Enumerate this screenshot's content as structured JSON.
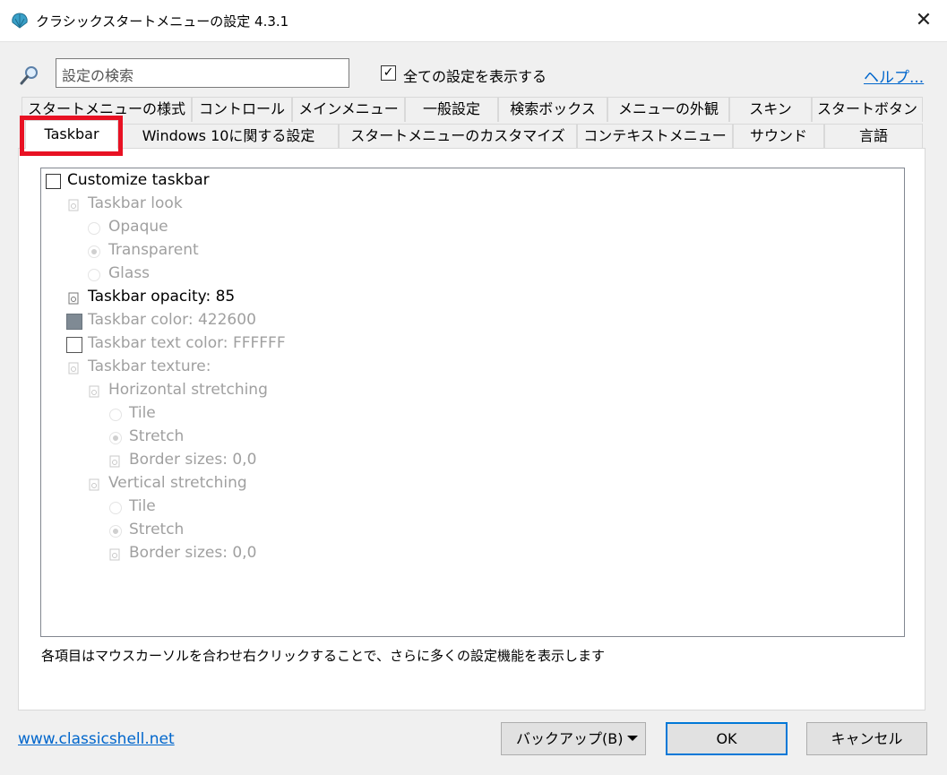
{
  "window": {
    "title": "クラシックスタートメニューの設定 4.3.1",
    "close_glyph": "✕"
  },
  "search": {
    "placeholder": "設定の検索",
    "show_all_label": "全ての設定を表示する",
    "show_all_checked": true,
    "help_link": "ヘルプ..."
  },
  "tabs_row1": [
    {
      "label": "スタートメニューの様式"
    },
    {
      "label": "コントロール"
    },
    {
      "label": "メインメニュー"
    },
    {
      "label": "一般設定"
    },
    {
      "label": "検索ボックス"
    },
    {
      "label": "メニューの外観"
    },
    {
      "label": "スキン"
    },
    {
      "label": "スタートボタン"
    }
  ],
  "tabs_row2": [
    {
      "label": "Taskbar",
      "active": true
    },
    {
      "label": "Windows 10に関する設定"
    },
    {
      "label": "スタートメニューのカスタマイズ"
    },
    {
      "label": "コンテキストメニュー"
    },
    {
      "label": "サウンド"
    },
    {
      "label": "言語"
    }
  ],
  "tree": {
    "customize_taskbar": "Customize taskbar",
    "taskbar_look": "Taskbar look",
    "opaque": "Opaque",
    "transparent": "Transparent",
    "glass": "Glass",
    "taskbar_opacity": "Taskbar opacity: 85",
    "taskbar_color": "Taskbar color: 422600",
    "taskbar_text_color": "Taskbar text color: FFFFFF",
    "taskbar_texture": "Taskbar texture:",
    "horizontal_stretching": "Horizontal stretching",
    "h_tile": "Tile",
    "h_stretch": "Stretch",
    "h_border_sizes": "Border sizes: 0,0",
    "vertical_stretching": "Vertical stretching",
    "v_tile": "Tile",
    "v_stretch": "Stretch",
    "v_border_sizes": "Border sizes: 0,0"
  },
  "hint": "各項目はマウスカーソルを合わせ右クリックすることで、さらに多くの設定機能を表示します",
  "footer": {
    "site_link": "www.classicshell.net",
    "backup_button": "バックアップ(B)",
    "ok_button": "OK",
    "cancel_button": "キャンセル"
  },
  "colors": {
    "taskbar_color_swatch": "#7f8a94",
    "accent_link": "#0066cc",
    "highlight": "#e81123"
  }
}
